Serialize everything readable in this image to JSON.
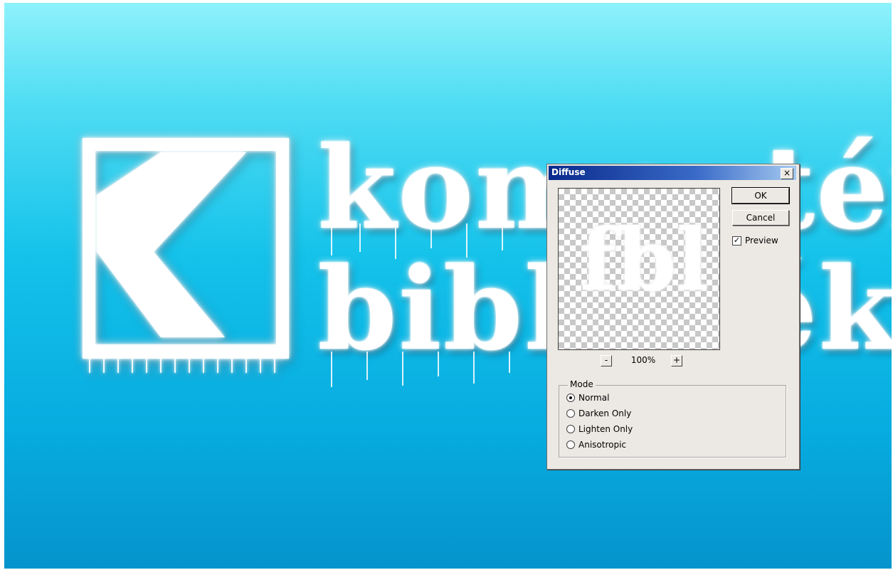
{
  "canvas": {
    "logo_line1": "komputér",
    "logo_line2": "bibliotéka"
  },
  "dialog": {
    "title": "Diffuse",
    "close_label": "×",
    "ok_label": "OK",
    "cancel_label": "Cancel",
    "preview_label": "Preview",
    "preview_checked": true,
    "preview_sample_text": "fbl",
    "zoom_out_label": "-",
    "zoom_in_label": "+",
    "zoom_level": "100%",
    "mode": {
      "legend": "Mode",
      "options": [
        "Normal",
        "Darken Only",
        "Lighten Only",
        "Anisotropic"
      ],
      "selected": "Normal"
    }
  },
  "colors": {
    "background_top": "#8ef2fb",
    "background_bottom": "#0594cc",
    "titlebar_start": "#0a2a8c",
    "dialog_face": "#ece9e4"
  }
}
